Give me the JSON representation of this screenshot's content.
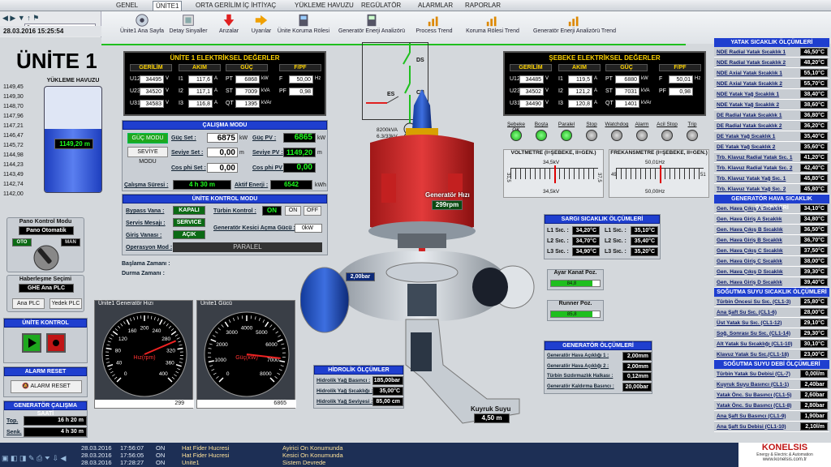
{
  "tabs": [
    "GENEL",
    "ÜNİTE1",
    "ORTA GERİLİM",
    "İÇ İHTİYAÇ",
    "YÜKLEME HAVUZU",
    "REGÜLATÖR",
    "ALARMLAR",
    "RAPORLAR"
  ],
  "nav": {
    "search_value": "a",
    "datetime": "28.03.2016   15:25:54"
  },
  "toolbar": [
    "Ünite1 Ana Sayfa",
    "Detay Sinyaller",
    "Arızalar",
    "Uyarılar",
    "Ünite Koruma Rölesi",
    "Generatör Enerji Analizörü",
    "Process Trend",
    "Koruma Rölesi Trend",
    "Generatör Enerji Analizörü Trend"
  ],
  "title": "ÜNİTE 1",
  "reservoir": {
    "title": "YÜKLEME HAVUZU",
    "level": "1149,20 m",
    "fill": 0.6,
    "scale": [
      "1149,45",
      "1149,30",
      "1148,70",
      "1147,96",
      "1147,21",
      "1146,47",
      "1145,72",
      "1144,98",
      "1144,23",
      "1143,49",
      "1142,74",
      "1142,00"
    ]
  },
  "unit_elec": {
    "title": "ÜNİTE 1 ELEKTRİKSEL DEĞERLER",
    "heads": [
      "GERİLİM",
      "AKIM",
      "GÜÇ",
      "F/PF"
    ],
    "rows": [
      [
        "U12",
        "34495",
        "V",
        "I1",
        "117,6",
        "A",
        "PT",
        "6868",
        "kW",
        "F",
        "50,00",
        "Hz"
      ],
      [
        "U23",
        "34520",
        "V",
        "I2",
        "117,1",
        "A",
        "ST",
        "7009",
        "kVA",
        "PF",
        "0,98",
        ""
      ],
      [
        "U31",
        "34583",
        "V",
        "I3",
        "116,8",
        "A",
        "QT",
        "1395",
        "kVAr",
        "",
        "",
        ""
      ]
    ]
  },
  "grid_elec": {
    "title": "ŞEBEKE ELEKTRİKSEL DEĞERLER",
    "heads": [
      "GERİLİM",
      "AKIM",
      "GÜÇ",
      "F/PF"
    ],
    "rows": [
      [
        "U12",
        "34485",
        "V",
        "I1",
        "119,5",
        "A",
        "PT",
        "6880",
        "kW",
        "F",
        "50,01",
        "Hz"
      ],
      [
        "U23",
        "34502",
        "V",
        "I2",
        "121,2",
        "A",
        "ST",
        "7031",
        "kVA",
        "PF",
        "0,98",
        ""
      ],
      [
        "U31",
        "34490",
        "V",
        "I3",
        "120,8",
        "A",
        "QT",
        "1401",
        "kVAr",
        "",
        "",
        ""
      ]
    ]
  },
  "mode": {
    "title": "ÇALIŞMA MODU",
    "btn1": "GÜÇ MODU",
    "btn2": "SEVİYE MODU",
    "gs_lbl": "Güç Set :",
    "gs_val": "6875",
    "gs_unit": "kW",
    "ss_lbl": "Seviye Set :",
    "ss_val": "0,00",
    "ss_unit": "m",
    "cs_lbl": "Cos phi Set :",
    "cs_val": "0,00",
    "pv_lbl": "Güç PV :",
    "pv_val": "6865",
    "pv_unit": "kW",
    "spv_lbl": "Seviye PV :",
    "spv_val": "1149,20",
    "spv_unit": "m",
    "cpv_lbl": "Cos phi PV :",
    "cpv_val": "0,00",
    "cs_time_lbl": "Çalışma Süresi :",
    "cs_time": "4 h 30 m",
    "ae_lbl": "Aktif Enerji :",
    "ae_val": "6542",
    "ae_unit": "kWh"
  },
  "control": {
    "title": "ÜNİTE KONTROL MODU",
    "bypass": "Bypass Vana :",
    "bypass_v": "KAPALI",
    "servis": "Servis Mesajı :",
    "servis_v": "SERVICE",
    "giris": "Giriş Vanası :",
    "giris_v": "AÇIK",
    "turbin": "Türbin Kontrol :",
    "on": "ON",
    "off": "OFF",
    "kesici": "Generatör Kesici Açma Gücü :",
    "kesici_v": "0kW",
    "oper": "Operasyon Mod :",
    "oper_v": "PARALEL"
  },
  "times": {
    "start": "Başlama Zamanı :",
    "stop": "Durma Zamanı :"
  },
  "pano": {
    "title": "Pano Kontrol Modu",
    "value": "Pano Otomatik",
    "oto": "OTO",
    "man": "MAN"
  },
  "comm": {
    "title": "Haberleşme Seçimi",
    "value": "GHE Ana PLC",
    "b1": "Ana PLC",
    "b2": "Yedek PLC"
  },
  "unitctl": {
    "title": "ÜNİTE KONTROL"
  },
  "alarm": {
    "title": "ALARM RESET",
    "btn": "ALARM RESET"
  },
  "genhours": {
    "title": "GENERATÖR ÇALIŞMA SAATİ",
    "top_lbl": "Top.",
    "top": "16 h 20 m",
    "senk_lbl": "Senk.",
    "senk": "4 h 30 m"
  },
  "gauge1": {
    "title": "Ünite1 Generatör Hızı",
    "label": "Hız(rpm)",
    "value": "299",
    "ticks": [
      "0",
      "40",
      "80",
      "120",
      "160",
      "200",
      "240",
      "280",
      "320",
      "360",
      "400"
    ],
    "frac": 0.7475
  },
  "gauge2": {
    "title": "Ünite1 Gücü",
    "label": "Güç(kW)",
    "value": "6865",
    "ticks": [
      "0",
      "1000",
      "2000",
      "3000",
      "4000",
      "5000",
      "6000",
      "7000",
      "8000"
    ],
    "frac": 0.858
  },
  "hydro": {
    "title": "HİDROLİK ÖLÇÜMLER",
    "rows": [
      [
        "Hidrolik Yağ Basıncı :",
        "185,00bar"
      ],
      [
        "Hidrolik Yağ Sıcaklığı :",
        "35,00°C"
      ],
      [
        "Hidrolik Yağ Seviyesi :",
        "85,00 cm"
      ]
    ]
  },
  "scheme": {
    "ds": "DS",
    "cb": "CB",
    "es": "ES",
    "tr": "8200kVA",
    "tr2": "6.3/33kV"
  },
  "signals": {
    "labels": [
      "Şebeke OK",
      "Boşta",
      "Paralel",
      "Stop",
      "Watchdog",
      "Alarm",
      "Acil Stop",
      "Trip"
    ],
    "states": [
      true,
      true,
      true,
      false,
      false,
      false,
      false,
      false
    ]
  },
  "volt_meter": {
    "title": "VOLTMETRE (I=ŞEBEKE, II=GEN.)",
    "top": "34,5kV",
    "bot": "34,5kV",
    "min": "31,5",
    "max": "37,5"
  },
  "freq_meter": {
    "title": "FREKANSMETRE (I=ŞEBEKE, II=GEN.)",
    "top": "50,01Hz",
    "bot": "50,00Hz",
    "min": "49",
    "max": "51"
  },
  "gen_speed": {
    "label": "Generatör Hızı",
    "value": "299rpm"
  },
  "pressure": "2,00bar",
  "tail": {
    "label": "Kuyruk Suyu",
    "value": "4,50 m"
  },
  "winding": {
    "title": "SARGI SICAKLIK ÖLÇÜMLERİ",
    "rows": [
      [
        "L1 Sıc. :",
        "34,20°C",
        "L1 Sıc. :",
        "35,10°C"
      ],
      [
        "L2 Sıc. :",
        "34,70°C",
        "L2 Sıc. :",
        "35,40°C"
      ],
      [
        "L3 Sıc. :",
        "34,90°C",
        "L3 Sıc. :",
        "35,20°C"
      ]
    ]
  },
  "ayar": {
    "title": "Ayar Kanat Poz.",
    "value": "84,8"
  },
  "runner": {
    "title": "Runner Poz.",
    "value": "85,8"
  },
  "genmeas": {
    "title": "GENERATÖR ÖLÇÜMLERİ",
    "rows": [
      [
        "Generatör Hava Açıklığı 1 :",
        "2,00mm"
      ],
      [
        "Generatör Hava Açıklığı 2 :",
        "2,00mm"
      ],
      [
        "Türbin Sızdırmazlık Halkası :",
        "0,12mm"
      ],
      [
        "Generatör Kaldırma Basıncı :",
        "20,00bar"
      ]
    ]
  },
  "bearing": {
    "title": "YATAK SICAKLIK ÖLÇÜMLERİ",
    "rows": [
      [
        "NDE Radial Yatak Sıcaklık 1",
        "46,50°C"
      ],
      [
        "NDE Radial Yatak Sıcaklık 2",
        "48,20°C"
      ],
      [
        "NDE Axial Yatak Sıcaklık 1",
        "55,10°C"
      ],
      [
        "NDE Axial Yatak Sıcaklık 2",
        "55,70°C"
      ],
      [
        "NDE Yatak Yağ Sıcaklık 1",
        "38,40°C"
      ],
      [
        "NDE Yatak Yağ Sıcaklık 2",
        "38,60°C"
      ],
      [
        "DE Radial Yatak Sıcaklık 1",
        "36,80°C"
      ],
      [
        "DE Radial Yatak Sıcaklık 2",
        "36,20°C"
      ],
      [
        "DE Yatak Yağ Sıcaklık 1",
        "35,40°C"
      ],
      [
        "DE Yatak Yağ Sıcaklık 2",
        "35,60°C"
      ],
      [
        "Trb. Klavuz Radial Yatak Sıc. 1",
        "41,20°C"
      ],
      [
        "Trb. Klavuz Radial Yatak Sıc. 2",
        "42,40°C"
      ],
      [
        "Trb. Klavuz Yatak Yağ Sıc. 1",
        "45,80°C"
      ],
      [
        "Trb. Klavuz Yatak Yağ Sıc. 2",
        "45,80°C"
      ]
    ]
  },
  "air": {
    "title": "GENERATÖR HAVA SICAKLIK ÖLÇÜMLERİ",
    "rows": [
      [
        "Gen. Hava Çıkış A Sıcaklık",
        "34,10°C"
      ],
      [
        "Gen. Hava Giriş A Sıcaklık",
        "34,80°C"
      ],
      [
        "Gen. Hava Çıkış B Sıcaklık",
        "36,50°C"
      ],
      [
        "Gen. Hava Giriş B Sıcaklık",
        "36,70°C"
      ],
      [
        "Gen. Hava Çıkış C Sıcaklık",
        "37,50°C"
      ],
      [
        "Gen. Hava Giriş C Sıcaklık",
        "38,00°C"
      ],
      [
        "Gen. Hava Çıkış D Sıcaklık",
        "39,30°C"
      ],
      [
        "Gen. Hava Giriş D Sıcaklık",
        "39,40°C"
      ]
    ]
  },
  "coolt": {
    "title": "SOĞUTMA SUYU SICAKLIK ÖLÇÜMLERİ",
    "rows": [
      [
        "Türbin Öncesi Su Sıc. (CL1-3)",
        "25,80°C"
      ],
      [
        "Ana Şaft Su Sıc. (CL1-6)",
        "28,00°C"
      ],
      [
        "Üst Yatak Su Sıc. (CL1-12)",
        "29,10°C"
      ],
      [
        "Soğ. Sonrası Su Sıc. (CL1-14)",
        "29,30°C"
      ],
      [
        "Alt Yatak Su Sıcaklığı (CL1-10)",
        "30,10°C"
      ],
      [
        "Klavuz Yatak Su Sıc.(CL1-18)",
        "23,00°C"
      ]
    ]
  },
  "coolf": {
    "title": "SOĞUTMA SUYU DEBİ ÖLÇÜMLERİ",
    "rows": [
      [
        "Türbin Yatak Su Debisi (CL-7)",
        "0,00l/m"
      ],
      [
        "Kuyruk Suyu Basıncı (CL1-1)",
        "2,40bar"
      ],
      [
        "Yatak Önc. Su Basıncı (CL1-5)",
        "2,60bar"
      ],
      [
        "Yatak Önc. Su Basıncı (CL1-8)",
        "2,80bar"
      ],
      [
        "Ana Şaft Su Basıncı (CL1-9)",
        "1,90bar"
      ],
      [
        "Ana Şaft Su Debisi (CL1-10)",
        "2,10l/m"
      ]
    ]
  },
  "events": [
    [
      "28.03.2016",
      "17:56:07",
      "ON",
      "Hat Fider Hucresi",
      "Ayirici On Konumunda"
    ],
    [
      "28.03.2016",
      "17:56:05",
      "ON",
      "Hat Fider Hucresi",
      "Kesici On Konumunda"
    ],
    [
      "28.03.2016",
      "17:28:27",
      "ON",
      "Unite1",
      "Sistem Devrede"
    ]
  ],
  "logo": {
    "name": "KONELSIS",
    "sub": "Energy & Electric & Automation",
    "url": "www.konelsis.com.tr"
  }
}
